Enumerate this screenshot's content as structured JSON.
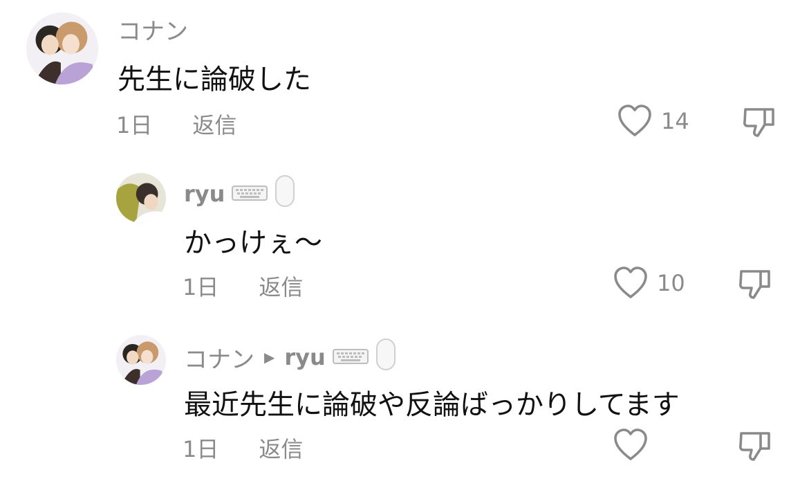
{
  "comments": [
    {
      "author": "コナン",
      "text": "先生に論破した",
      "time": "1日",
      "reply_label": "返信",
      "likes": "14"
    },
    {
      "author": "ryu",
      "text": "かっけぇ〜",
      "time": "1日",
      "reply_label": "返信",
      "likes": "10"
    },
    {
      "author": "コナン",
      "reply_to": "ryu",
      "text": "最近先生に論破や反論ばっかりしてます",
      "time": "1日",
      "reply_label": "返信",
      "likes": ""
    }
  ],
  "icons": {
    "like": "heart-outline-icon",
    "dislike": "thumbs-down-outline-icon",
    "reply_arrow": "triangle-right-icon",
    "emoji_1": "keyboard-icon",
    "emoji_2": "mouse-icon"
  },
  "colors": {
    "text": "#111111",
    "secondary": "#8a8a8a",
    "background": "#ffffff"
  }
}
